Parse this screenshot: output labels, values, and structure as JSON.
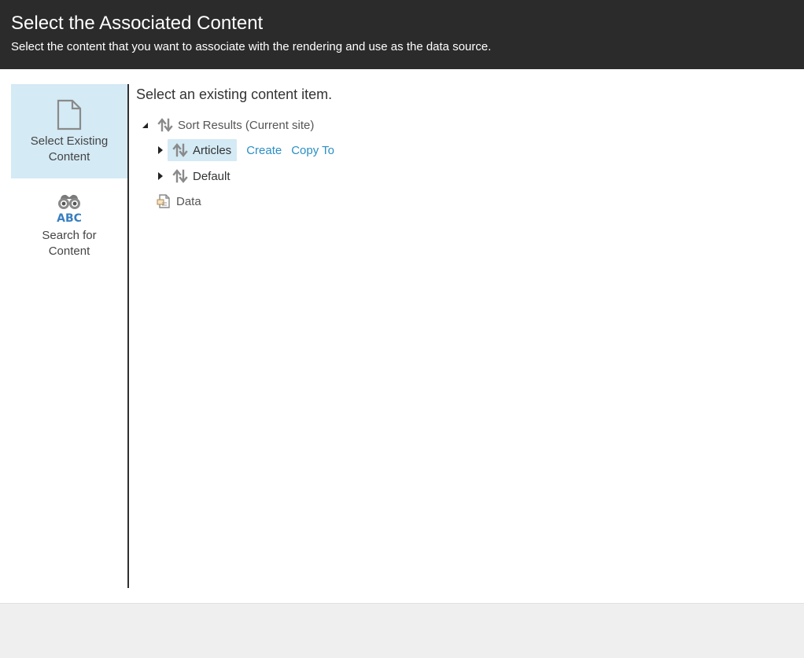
{
  "header": {
    "title": "Select the Associated Content",
    "subtitle": "Select the content that you want to associate with the rendering and use as the data source."
  },
  "sidebar": {
    "items": [
      {
        "label_line1": "Select Existing",
        "label_line2": "Content",
        "icon": "document-icon",
        "active": true
      },
      {
        "label_line1": "Search for",
        "label_line2": "Content",
        "icon": "binoculars-abc-icon",
        "active": false
      }
    ]
  },
  "main": {
    "heading": "Select an existing content item.",
    "tree": {
      "root": {
        "label": "Sort Results (Current site)",
        "expanded": true,
        "icon": "sort-arrows-icon"
      },
      "children": [
        {
          "label": "Articles",
          "selected": true,
          "icon": "sort-arrows-icon",
          "actions": [
            "Create",
            "Copy To"
          ]
        },
        {
          "label": "Default",
          "selected": false,
          "icon": "sort-arrows-icon"
        },
        {
          "label": "Data",
          "selected": false,
          "icon": "data-document-icon"
        }
      ]
    }
  },
  "colors": {
    "header_bg": "#2b2b2b",
    "active_bg": "#d4eaf5",
    "link": "#2b8fc6",
    "footer_bg": "#efefef"
  }
}
